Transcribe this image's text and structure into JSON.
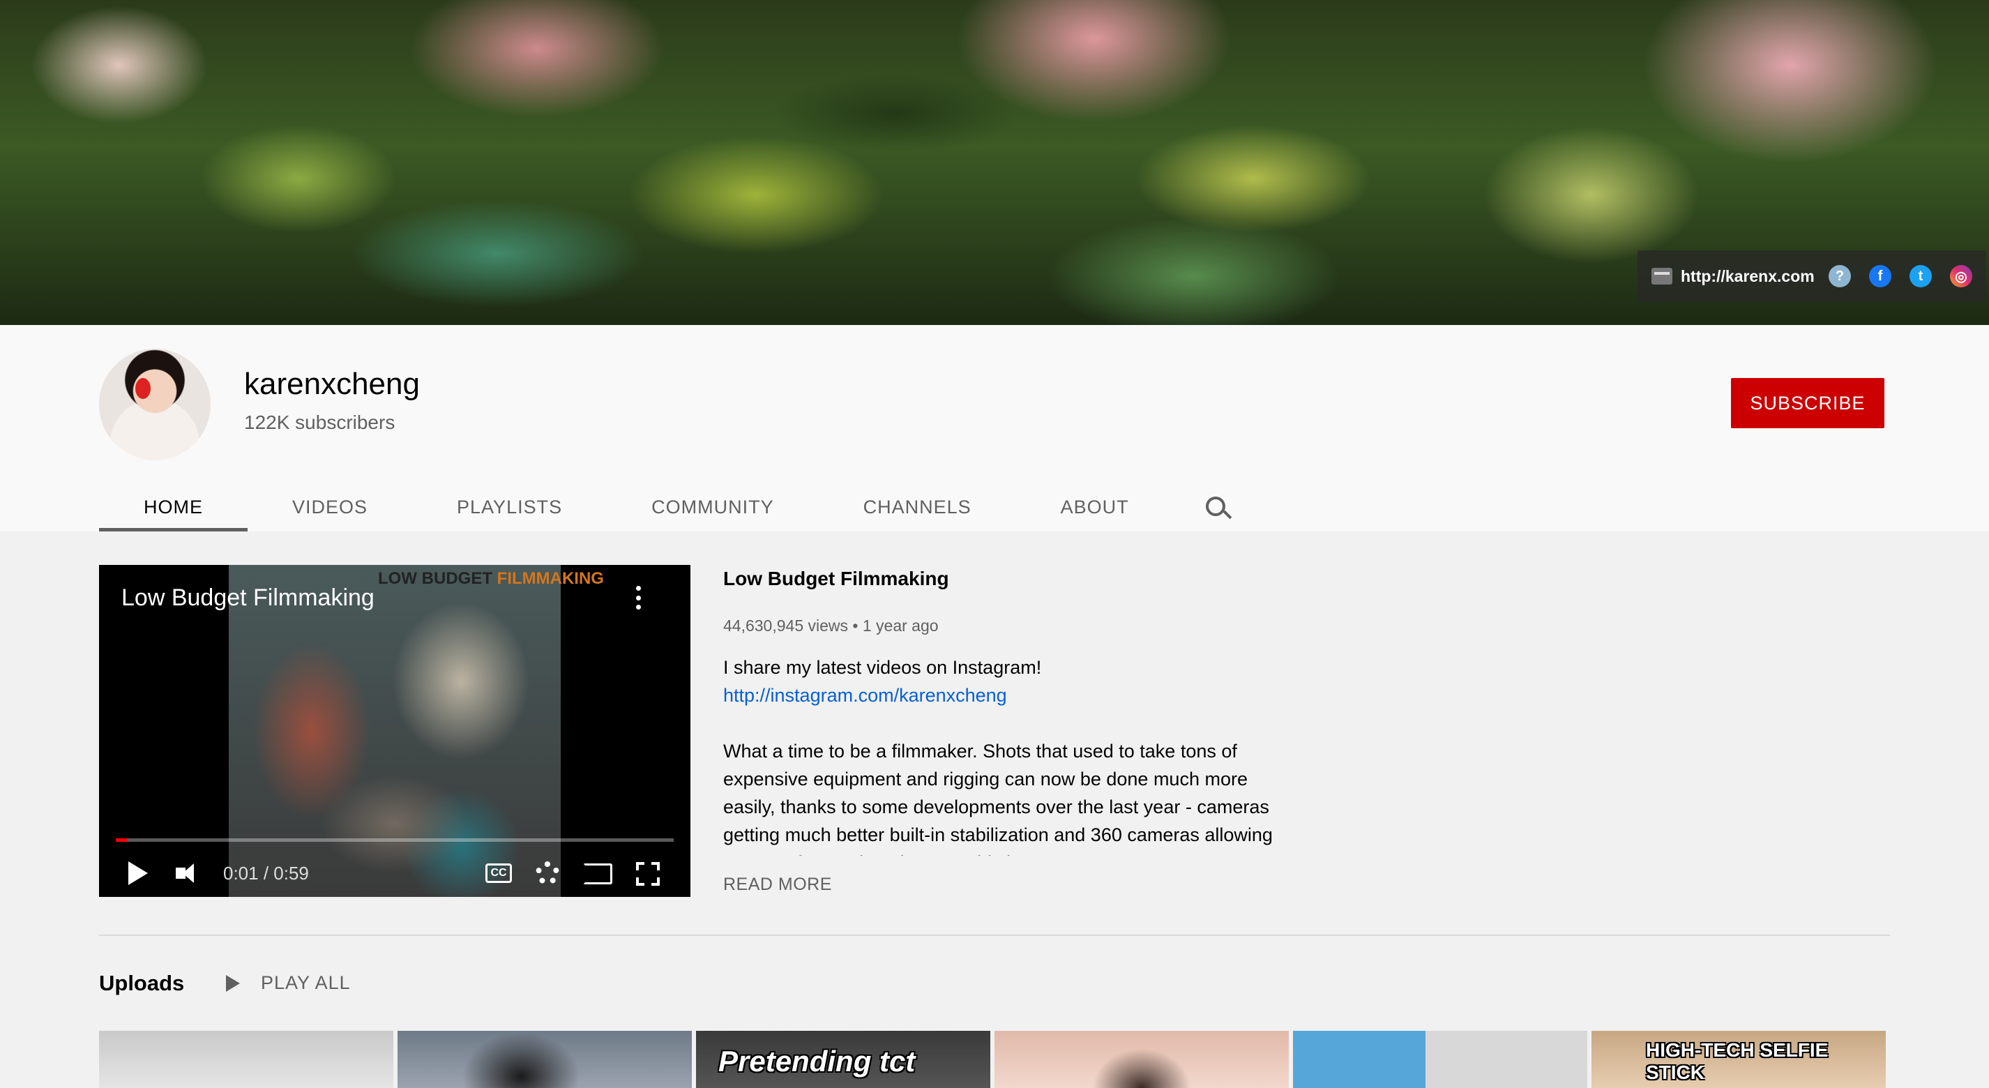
{
  "banner": {
    "link_text": "http://karenx.com",
    "social_icons": [
      "quora-icon",
      "facebook-icon",
      "twitter-icon",
      "instagram-icon"
    ]
  },
  "channel": {
    "name": "karenxcheng",
    "subscribers": "122K subscribers",
    "subscribe_label": "SUBSCRIBE",
    "subscribe_color": "#cc0000"
  },
  "tabs": [
    {
      "label": "HOME",
      "active": true
    },
    {
      "label": "VIDEOS"
    },
    {
      "label": "PLAYLISTS"
    },
    {
      "label": "COMMUNITY"
    },
    {
      "label": "CHANNELS"
    },
    {
      "label": "ABOUT"
    }
  ],
  "featured": {
    "player_title": "Low Budget Filmmaking",
    "thumb_caption_dark": "LOW BUDGET",
    "thumb_caption_orange": "FILMMAKING",
    "time": "0:01 / 0:59",
    "progress": 0.02,
    "cc_label": "CC",
    "title": "Low Budget Filmmaking",
    "meta": "44,630,945 views • 1 year ago",
    "desc_line1": "I share my latest videos on Instagram!",
    "desc_link": "http://instagram.com/karenxcheng",
    "desc_body": "What a time to be a filmmaker. Shots that used to take tons of expensive equipment and rigging can now be done much more easily, thanks to some developments over the last year - cameras getting much better built-in stabilization and 360 cameras allowing you to reframe shots in post. This is a",
    "read_more": "READ MORE"
  },
  "uploads": {
    "title": "Uploads",
    "play_all": "PLAY ALL",
    "thumb_texts": [
      "",
      "",
      "Pretending tct",
      "",
      "",
      "HIGH-TECH SELFIE STICK"
    ]
  },
  "accent_colors": {
    "link": "#065fd4",
    "subscribe": "#cc0000",
    "progress": "#ff0000"
  }
}
